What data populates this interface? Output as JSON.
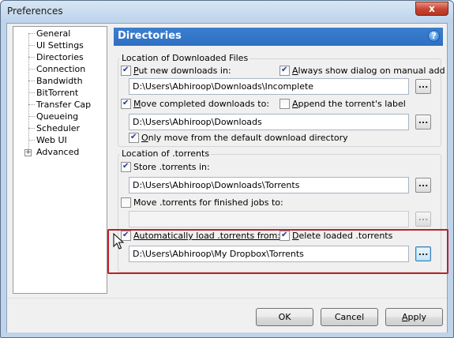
{
  "window": {
    "title": "Preferences",
    "close_label": "x"
  },
  "tree": {
    "items": [
      {
        "label": "General"
      },
      {
        "label": "UI Settings"
      },
      {
        "label": "Directories"
      },
      {
        "label": "Connection"
      },
      {
        "label": "Bandwidth"
      },
      {
        "label": "BitTorrent"
      },
      {
        "label": "Transfer Cap"
      },
      {
        "label": "Queueing"
      },
      {
        "label": "Scheduler"
      },
      {
        "label": "Web UI"
      },
      {
        "label": "Advanced"
      }
    ],
    "expander_symbol": "+"
  },
  "header": {
    "title": "Directories",
    "help_symbol": "?"
  },
  "downloaded": {
    "group_label": "Location of Downloaded Files",
    "put_new_prefix": "P",
    "put_new_rest": "ut new downloads in:",
    "put_new_checked": true,
    "always_show_prefix": "A",
    "always_show_rest": "lways show dialog on manual add",
    "always_show_checked": true,
    "incomplete_path": "D:\\Users\\Abhiroop\\Downloads\\Incomplete",
    "move_completed_prefix": "M",
    "move_completed_rest": "ove completed downloads to:",
    "move_completed_checked": true,
    "append_label_prefix": "A",
    "append_label_rest": "ppend the torrent's label",
    "append_label_checked": false,
    "completed_path": "D:\\Users\\Abhiroop\\Downloads",
    "only_move_prefix": "O",
    "only_move_rest": "nly move from the default download directory",
    "only_move_checked": true
  },
  "torrents": {
    "group_label": "Location of .torrents",
    "store_label": "Store .torrents in:",
    "store_checked": true,
    "store_path": "D:\\Users\\Abhiroop\\Downloads\\Torrents",
    "move_finished_label": "Move .torrents for finished jobs to:",
    "move_finished_checked": false,
    "move_finished_path": "",
    "auto_load_prefix": "A",
    "auto_load_rest": "utomatically load .torrents from:",
    "auto_load_checked": true,
    "delete_loaded_prefix": "D",
    "delete_loaded_rest": "elete loaded .torrents",
    "delete_loaded_checked": true,
    "auto_load_path": "D:\\Users\\Abhiroop\\My Dropbox\\Torrents"
  },
  "browse_label": "...",
  "buttons": {
    "ok": "OK",
    "cancel": "Cancel",
    "apply_prefix": "A",
    "apply_rest": "pply"
  },
  "colors": {
    "accent": "#2e6fc2",
    "highlight_border": "#b8222a"
  }
}
